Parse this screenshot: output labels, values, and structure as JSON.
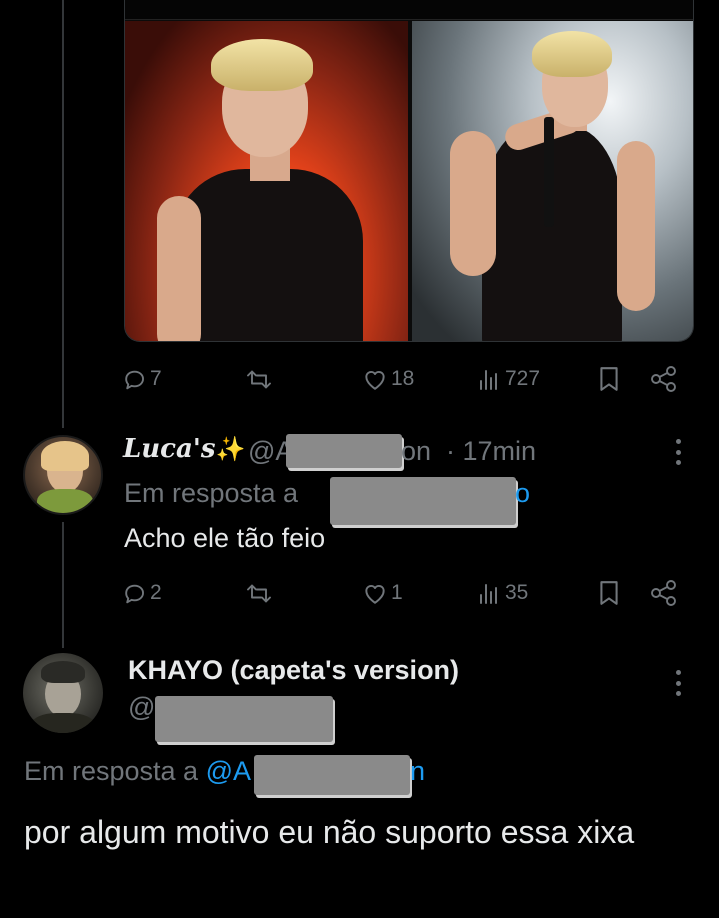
{
  "post1": {
    "actions": {
      "reply_count": "7",
      "like_count": "18",
      "views_count": "727"
    }
  },
  "reply1": {
    "display_name": "Luca's",
    "handle_start": "@A",
    "handle_end": "on",
    "time": "· 17min",
    "reply_to_label": "Em resposta a",
    "reply_to_handle_end": "o",
    "text": "Acho ele tão feio",
    "actions": {
      "reply_count": "2",
      "like_count": "1",
      "views_count": "35"
    }
  },
  "reply2": {
    "display_name": "KHAYO (capeta's version)",
    "handle_start": "@",
    "reply_to_label": "Em resposta a",
    "reply_to_handle_start": "@A",
    "reply_to_handle_end": "n",
    "text": "por algum motivo eu não suporto essa xixa"
  },
  "icons": [
    "reply-icon",
    "retweet-icon",
    "like-icon",
    "views-icon",
    "bookmark-icon",
    "share-icon",
    "more-icon",
    "sparkles-icon"
  ],
  "colors": {
    "background": "#000000",
    "text": "#e7e9ea",
    "muted": "#71767b",
    "link": "#1d9bf0",
    "redaction": "#8a8a8a"
  }
}
